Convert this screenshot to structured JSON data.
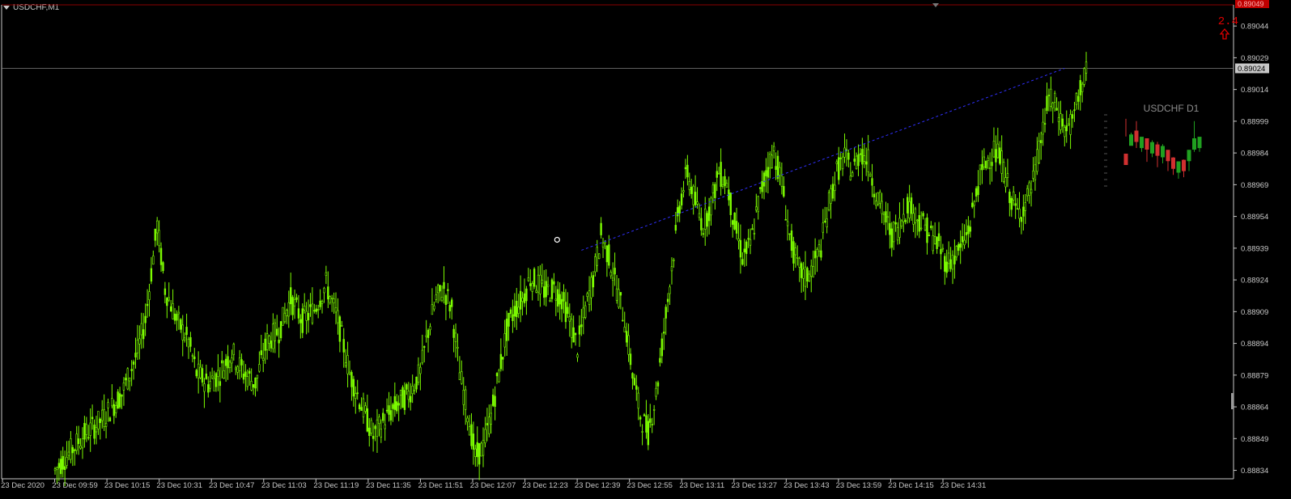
{
  "window": {
    "symbol_label": "USDCHF,M1"
  },
  "indicator": {
    "value": "2.4",
    "arrow": "up-arrow-icon",
    "color": "#e00000"
  },
  "mini_chart": {
    "title": "USDCHF D1",
    "candles": [
      [
        0.4,
        0.98,
        0.75,
        "#d03030"
      ],
      [
        0.65,
        0.8,
        0.65,
        "#20a020"
      ],
      [
        0.7,
        0.95,
        0.6,
        "#d03030"
      ],
      [
        0.62,
        0.72,
        0.55,
        "#20a020"
      ],
      [
        0.6,
        0.7,
        0.42,
        "#d03030"
      ],
      [
        0.55,
        0.7,
        0.48,
        "#20a020"
      ],
      [
        0.52,
        0.68,
        0.35,
        "#d03030"
      ],
      [
        0.5,
        0.65,
        0.4,
        "#20a020"
      ],
      [
        0.45,
        0.55,
        0.3,
        "#d03030"
      ],
      [
        0.35,
        0.48,
        0.25,
        "#d03030"
      ],
      [
        0.3,
        0.42,
        0.2,
        "#20a020"
      ],
      [
        0.32,
        0.45,
        0.22,
        "#d03030"
      ],
      [
        0.45,
        0.55,
        0.3,
        "#20a020"
      ],
      [
        0.6,
        0.95,
        0.55,
        "#20a020"
      ],
      [
        0.62,
        0.7,
        0.55,
        "#20a020"
      ]
    ]
  },
  "chart_data": {
    "type": "candlestick",
    "title": "USDCHF,M1",
    "y_axis": {
      "ticks": [
        "0.89044",
        "0.89029",
        "0.89014",
        "0.88999",
        "0.88984",
        "0.88969",
        "0.88954",
        "0.88939",
        "0.88924",
        "0.88909",
        "0.88894",
        "0.88879",
        "0.88864",
        "0.88849",
        "0.88834"
      ],
      "range": [
        0.8883,
        0.89054
      ],
      "current_price_label": "0.89024",
      "top_label": "0.89049",
      "current_price": 0.89024
    },
    "x_axis": {
      "ticks": [
        "23 Dec 2020",
        "23 Dec 09:59",
        "23 Dec 10:15",
        "23 Dec 10:31",
        "23 Dec 10:47",
        "23 Dec 11:03",
        "23 Dec 11:19",
        "23 Dec 11:35",
        "23 Dec 11:51",
        "23 Dec 12:07",
        "23 Dec 12:23",
        "23 Dec 12:39",
        "23 Dec 12:55",
        "23 Dec 13:11",
        "23 Dec 13:27",
        "23 Dec 13:43",
        "23 Dec 13:59",
        "23 Dec 14:15",
        "23 Dec 14:31"
      ]
    },
    "price_path": [
      [
        0,
        0.88834
      ],
      [
        14,
        0.8885
      ],
      [
        24,
        0.88858
      ],
      [
        34,
        0.8887
      ],
      [
        42,
        0.8889
      ],
      [
        46,
        0.88905
      ],
      [
        52,
        0.8895
      ],
      [
        56,
        0.8892
      ],
      [
        62,
        0.88905
      ],
      [
        68,
        0.88895
      ],
      [
        72,
        0.8888
      ],
      [
        78,
        0.88875
      ],
      [
        84,
        0.8888
      ],
      [
        90,
        0.8889
      ],
      [
        96,
        0.8888
      ],
      [
        102,
        0.88875
      ],
      [
        108,
        0.88895
      ],
      [
        114,
        0.889
      ],
      [
        120,
        0.88915
      ],
      [
        126,
        0.88905
      ],
      [
        132,
        0.8891
      ],
      [
        138,
        0.88922
      ],
      [
        144,
        0.88905
      ],
      [
        150,
        0.8888
      ],
      [
        156,
        0.88865
      ],
      [
        162,
        0.8885
      ],
      [
        168,
        0.88858
      ],
      [
        174,
        0.88865
      ],
      [
        180,
        0.8887
      ],
      [
        186,
        0.8888
      ],
      [
        190,
        0.889
      ],
      [
        194,
        0.88915
      ],
      [
        198,
        0.8892
      ],
      [
        202,
        0.8891
      ],
      [
        206,
        0.8888
      ],
      [
        210,
        0.88862
      ],
      [
        214,
        0.8884
      ],
      [
        218,
        0.88845
      ],
      [
        222,
        0.8886
      ],
      [
        226,
        0.8888
      ],
      [
        230,
        0.889
      ],
      [
        234,
        0.8891
      ],
      [
        238,
        0.88915
      ],
      [
        242,
        0.88925
      ],
      [
        246,
        0.88922
      ],
      [
        250,
        0.88918
      ],
      [
        254,
        0.8892
      ],
      [
        258,
        0.88915
      ],
      [
        262,
        0.88905
      ],
      [
        266,
        0.88892
      ],
      [
        270,
        0.8891
      ],
      [
        274,
        0.88925
      ],
      [
        278,
        0.88945
      ],
      [
        282,
        0.88935
      ],
      [
        286,
        0.8892
      ],
      [
        290,
        0.88905
      ],
      [
        294,
        0.8888
      ],
      [
        298,
        0.8886
      ],
      [
        302,
        0.88852
      ],
      [
        306,
        0.8887
      ],
      [
        310,
        0.889
      ],
      [
        314,
        0.8893
      ],
      [
        318,
        0.8896
      ],
      [
        322,
        0.88975
      ],
      [
        326,
        0.8896
      ],
      [
        330,
        0.8895
      ],
      [
        334,
        0.8896
      ],
      [
        338,
        0.88975
      ],
      [
        342,
        0.8897
      ],
      [
        346,
        0.8895
      ],
      [
        350,
        0.88935
      ],
      [
        354,
        0.8894
      ],
      [
        358,
        0.8896
      ],
      [
        362,
        0.88975
      ],
      [
        366,
        0.88985
      ],
      [
        370,
        0.8897
      ],
      [
        374,
        0.88945
      ],
      [
        378,
        0.8893
      ],
      [
        382,
        0.88925
      ],
      [
        386,
        0.8893
      ],
      [
        390,
        0.8894
      ],
      [
        394,
        0.8896
      ],
      [
        398,
        0.88975
      ],
      [
        402,
        0.88982
      ],
      [
        406,
        0.88975
      ],
      [
        410,
        0.88985
      ],
      [
        414,
        0.8898
      ],
      [
        418,
        0.88965
      ],
      [
        422,
        0.88955
      ],
      [
        426,
        0.88945
      ],
      [
        430,
        0.8895
      ],
      [
        434,
        0.8896
      ],
      [
        438,
        0.88955
      ],
      [
        442,
        0.8895
      ],
      [
        446,
        0.88945
      ],
      [
        450,
        0.8894
      ],
      [
        454,
        0.88932
      ],
      [
        458,
        0.88935
      ],
      [
        462,
        0.8894
      ],
      [
        466,
        0.8895
      ],
      [
        470,
        0.8897
      ],
      [
        474,
        0.8898
      ],
      [
        478,
        0.88985
      ],
      [
        482,
        0.8898
      ],
      [
        486,
        0.88965
      ],
      [
        490,
        0.88955
      ],
      [
        494,
        0.8896
      ],
      [
        498,
        0.8897
      ],
      [
        502,
        0.8899
      ],
      [
        506,
        0.8901
      ],
      [
        510,
        0.89005
      ],
      [
        514,
        0.88995
      ],
      [
        518,
        0.88998
      ],
      [
        522,
        0.89015
      ],
      [
        526,
        0.89024
      ]
    ],
    "trendline": {
      "from": [
        268,
        0.88938
      ],
      "to": [
        514,
        0.89024
      ],
      "color": "#3030ff"
    },
    "colors": {
      "bull": "#7cfc00",
      "bear": "#7cfc00",
      "background": "#000000",
      "axis": "#c8c8c8"
    }
  }
}
